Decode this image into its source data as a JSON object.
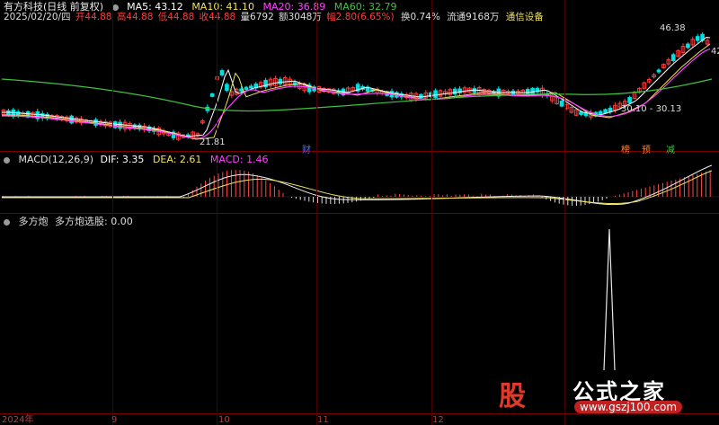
{
  "header": {
    "stock_name": "有方科技(日线 前复权)",
    "ma5": "MA5: 43.12",
    "ma10": "MA10: 41.10",
    "ma20": "MA20: 36.89",
    "ma60": "MA60: 32.79",
    "date": "2025/02/20/四",
    "open": "开44.88",
    "high": "高44.88",
    "low": "低44.88",
    "close": "收44.88",
    "volume": "量6792",
    "amount": "额3048万",
    "change": "幅2.80(6.65%)",
    "turnover": "换0.74%",
    "float": "流通9168万",
    "sector": "通信设备"
  },
  "price_panel": {
    "high_label": "46.38",
    "low_label": "21.81",
    "range_label": "30.10 - 30.13",
    "right_edge_label": "42",
    "markers": [
      "财",
      "榜",
      "预",
      "减"
    ]
  },
  "macd_panel": {
    "title": "MACD(12,26,9)",
    "dif": "DIF: 3.35",
    "dea": "DEA: 2.61",
    "macd": "MACD: 1.46"
  },
  "indicator_panel": {
    "title": "多方炮",
    "subtitle": "多方炮选股: 0.00"
  },
  "time_axis": [
    "2024年",
    "9",
    "10",
    "11",
    "12"
  ],
  "watermark": {
    "logo": "股",
    "title": "公式之家",
    "url": "www.gszj100.com"
  },
  "colors": {
    "up": "#ff3b3b",
    "down": "#00e0e0",
    "ma5": "#ffffff",
    "ma10": "#f0e060",
    "ma20": "#ff40ff",
    "ma60": "#40c040",
    "grid": "#7a0000"
  }
}
